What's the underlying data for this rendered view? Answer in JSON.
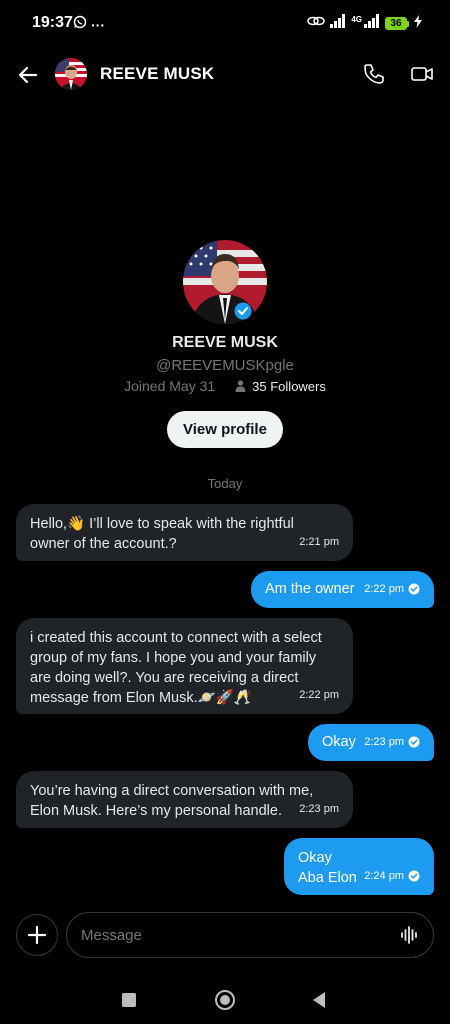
{
  "status_bar": {
    "time": "19:37",
    "more": "···",
    "network_label": "4G",
    "battery_level": "36",
    "battery_color": "#7ed321"
  },
  "header": {
    "name": "REEVE MUSK",
    "icons": [
      "arrow-left-icon",
      "phone-icon",
      "video-camera-icon"
    ]
  },
  "profile": {
    "name": "REEVE MUSK",
    "handle": "@REEVEMUSKpgle",
    "joined": "Joined May 31",
    "followers": "35 Followers",
    "view_profile_label": "View profile"
  },
  "date_separator": "Today",
  "messages": [
    {
      "direction": "incoming",
      "lines": [
        "Hello,👋 I’ll love to speak with the rightful",
        "owner of the account.?"
      ],
      "time": "2:21 pm"
    },
    {
      "direction": "outgoing",
      "lines": [
        "Am the owner"
      ],
      "time": "2:22 pm"
    },
    {
      "direction": "incoming",
      "lines": [
        "i created this account to connect with a select",
        "group of my fans. I hope you and your family",
        "are doing well?. You are receiving a direct",
        "message from Elon Musk.🪐🚀🥂"
      ],
      "time": "2:22 pm"
    },
    {
      "direction": "outgoing",
      "lines": [
        "Okay"
      ],
      "time": "2:23 pm"
    },
    {
      "direction": "incoming",
      "lines": [
        "You’re having a direct conversation with me,",
        "Elon Musk. Here’s my personal handle."
      ],
      "time": "2:23 pm"
    },
    {
      "direction": "outgoing",
      "lines": [
        "Okay",
        "Aba Elon"
      ],
      "time": "2:24 pm"
    }
  ],
  "composer": {
    "placeholder": "Message"
  },
  "colors": {
    "background": "#000000",
    "incoming_bubble": "#202327",
    "outgoing_bubble": "#1d9bf0",
    "muted_text": "#71767b"
  }
}
